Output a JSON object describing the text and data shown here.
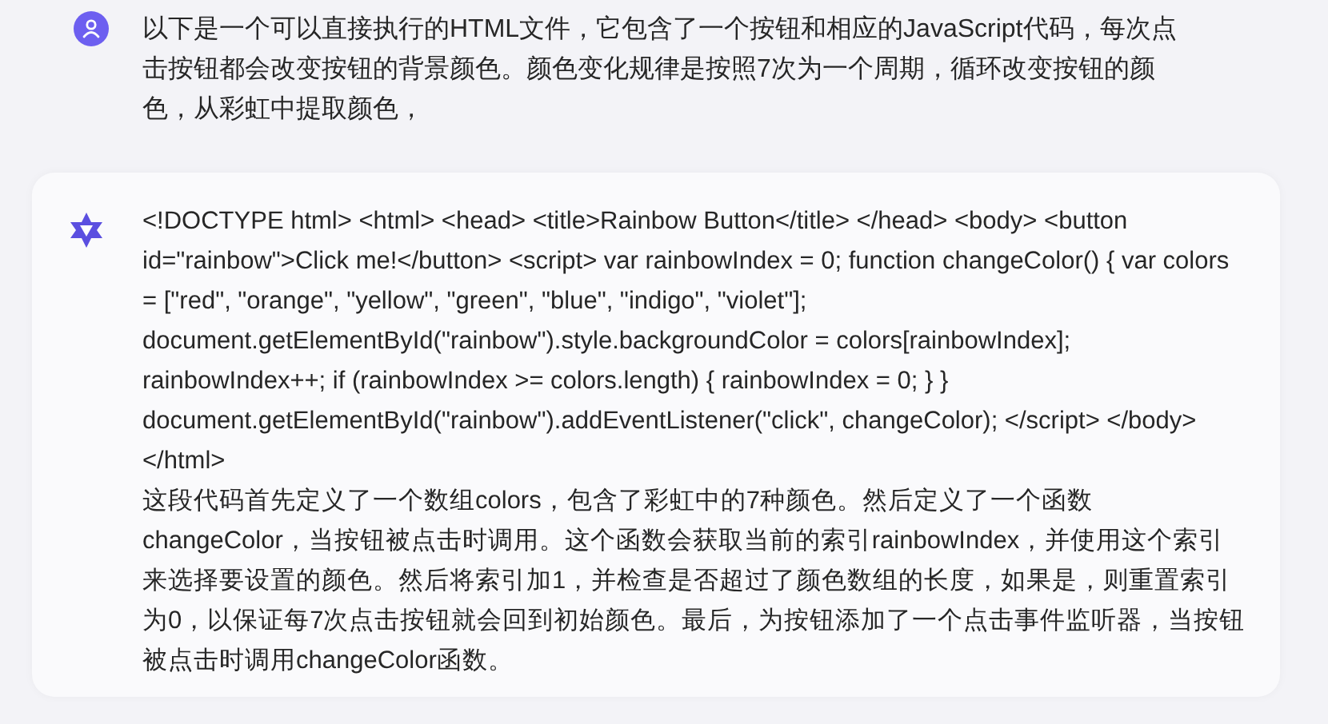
{
  "messages": [
    {
      "kind": "user",
      "paragraphs": [
        "以下是一个可以直接执行的HTML文件，它包含了一个按钮和相应的JavaScript代码，每次点击按钮都会改变按钮的背景颜色。颜色变化规律是按照7次为一个周期，循环改变按钮的颜色，从彩虹中提取颜色，"
      ]
    },
    {
      "kind": "assistant",
      "paragraphs": [
        "<!DOCTYPE html> <html> <head> <title>Rainbow Button</title> </head> <body> <button id=\"rainbow\">Click me!</button> <script> var rainbowIndex = 0; function changeColor() { var colors = [\"red\", \"orange\", \"yellow\", \"green\", \"blue\", \"indigo\", \"violet\"]; document.getElementById(\"rainbow\").style.backgroundColor = colors[rainbowIndex]; rainbowIndex++; if (rainbowIndex >= colors.length) { rainbowIndex = 0; } } document.getElementById(\"rainbow\").addEventListener(\"click\", changeColor); </script> </body> </html>",
        "这段代码首先定义了一个数组colors，包含了彩虹中的7种颜色。然后定义了一个函数changeColor，当按钮被点击时调用。这个函数会获取当前的索引rainbowIndex，并使用这个索引来选择要设置的颜色。然后将索引加1，并检查是否超过了颜色数组的长度，如果是，则重置索引为0，以保证每7次点击按钮就会回到初始颜色。最后，为按钮添加了一个点击事件监听器，当按钮被点击时调用changeColor函数。"
      ]
    }
  ]
}
